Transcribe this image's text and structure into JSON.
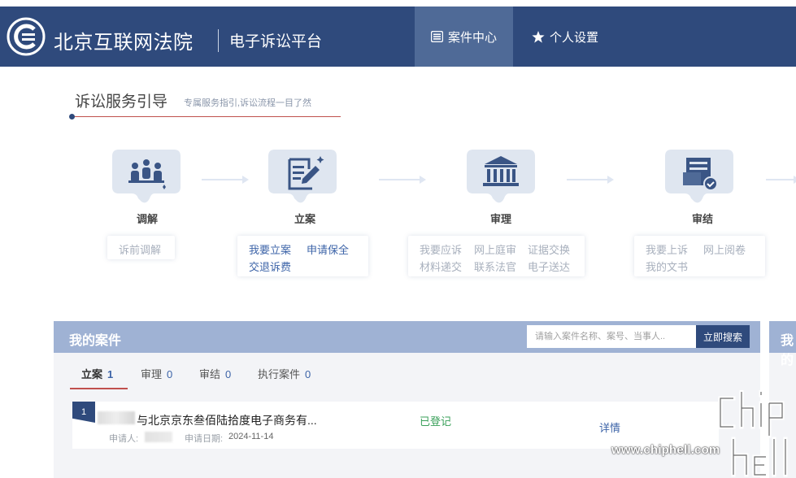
{
  "header": {
    "site_name": "北京互联网法院",
    "platform_name": "电子诉讼平台",
    "nav": [
      {
        "label": "案件中心",
        "icon": "list-icon",
        "active": true
      },
      {
        "label": "个人设置",
        "icon": "star-icon",
        "active": false
      }
    ],
    "colors": {
      "bg": "#2f4a7c",
      "active": "#4f6a97"
    }
  },
  "guide": {
    "title": "诉讼服务引导",
    "subtitle": "专属服务指引,诉讼流程一目了然",
    "stages": [
      {
        "label": "调解",
        "icon": "people-icon",
        "links": [
          "诉前调解"
        ]
      },
      {
        "label": "立案",
        "icon": "document-edit-icon",
        "links": [
          "我要立案",
          "申请保全",
          "交退诉费"
        ]
      },
      {
        "label": "审理",
        "icon": "courthouse-icon",
        "links": [
          "我要应诉",
          "网上庭审",
          "证据交换",
          "材料递交",
          "联系法官",
          "电子送达"
        ]
      },
      {
        "label": "审结",
        "icon": "verified-document-icon",
        "links": [
          "我要上诉",
          "网上阅卷",
          "我的文书"
        ]
      }
    ]
  },
  "cases": {
    "title": "我的案件",
    "search_placeholder": "请输入案件名称、案号、当事人..",
    "search_button": "立即搜索",
    "tabs": [
      {
        "label": "立案",
        "count": "1",
        "active": true
      },
      {
        "label": "审理",
        "count": "0",
        "active": false
      },
      {
        "label": "审结",
        "count": "0",
        "active": false
      },
      {
        "label": "执行案件",
        "count": "0",
        "active": false
      }
    ],
    "rows": [
      {
        "index": "1",
        "name": "与北京京东叁佰陆拾度电子商务有...",
        "status": "已登记",
        "detail": "详情",
        "applicant_label": "申请人:",
        "date_label": "申请日期:",
        "date": "2024-11-14"
      }
    ]
  },
  "right_panel": {
    "title": "我的"
  },
  "watermark": {
    "text": "www.chiphell.com"
  }
}
